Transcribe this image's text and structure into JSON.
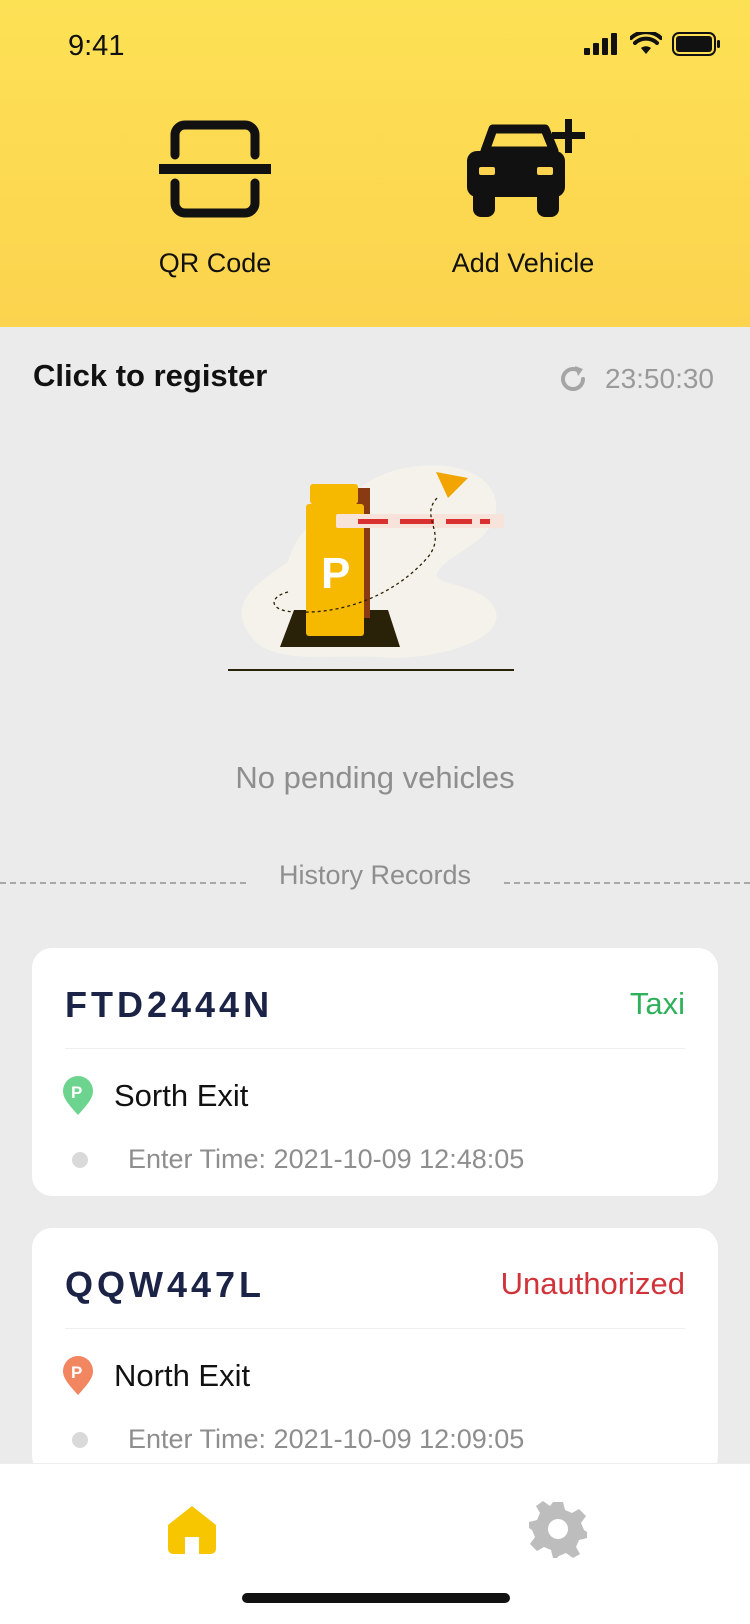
{
  "status_bar": {
    "time": "9:41"
  },
  "actions": {
    "qr": {
      "label": "QR Code",
      "icon": "qr-scan-icon"
    },
    "add_vehicle": {
      "label": "Add Vehicle",
      "icon": "car-add-icon"
    }
  },
  "register": {
    "title": "Click to register",
    "timer": "23:50:30",
    "empty_text": "No pending vehicles"
  },
  "history": {
    "label": "History Records",
    "records": [
      {
        "plate": "FTD2444N",
        "status": "Taxi",
        "status_color": "#2fb05a",
        "location": "Sorth Exit",
        "pin_color": "#6cd48f",
        "enter_time": "Enter Time: 2021-10-09 12:48:05"
      },
      {
        "plate": "QQW447L",
        "status": "Unauthorized",
        "status_color": "#d0343a",
        "location": "North Exit",
        "pin_color": "#f28660",
        "enter_time": "Enter Time: 2021-10-09 12:09:05"
      }
    ]
  },
  "tabbar": {
    "active_color": "#f7c600",
    "inactive_color": "#bdbdbd",
    "tabs": [
      {
        "icon": "home-icon",
        "active": true
      },
      {
        "icon": "gear-icon",
        "active": false
      }
    ]
  }
}
